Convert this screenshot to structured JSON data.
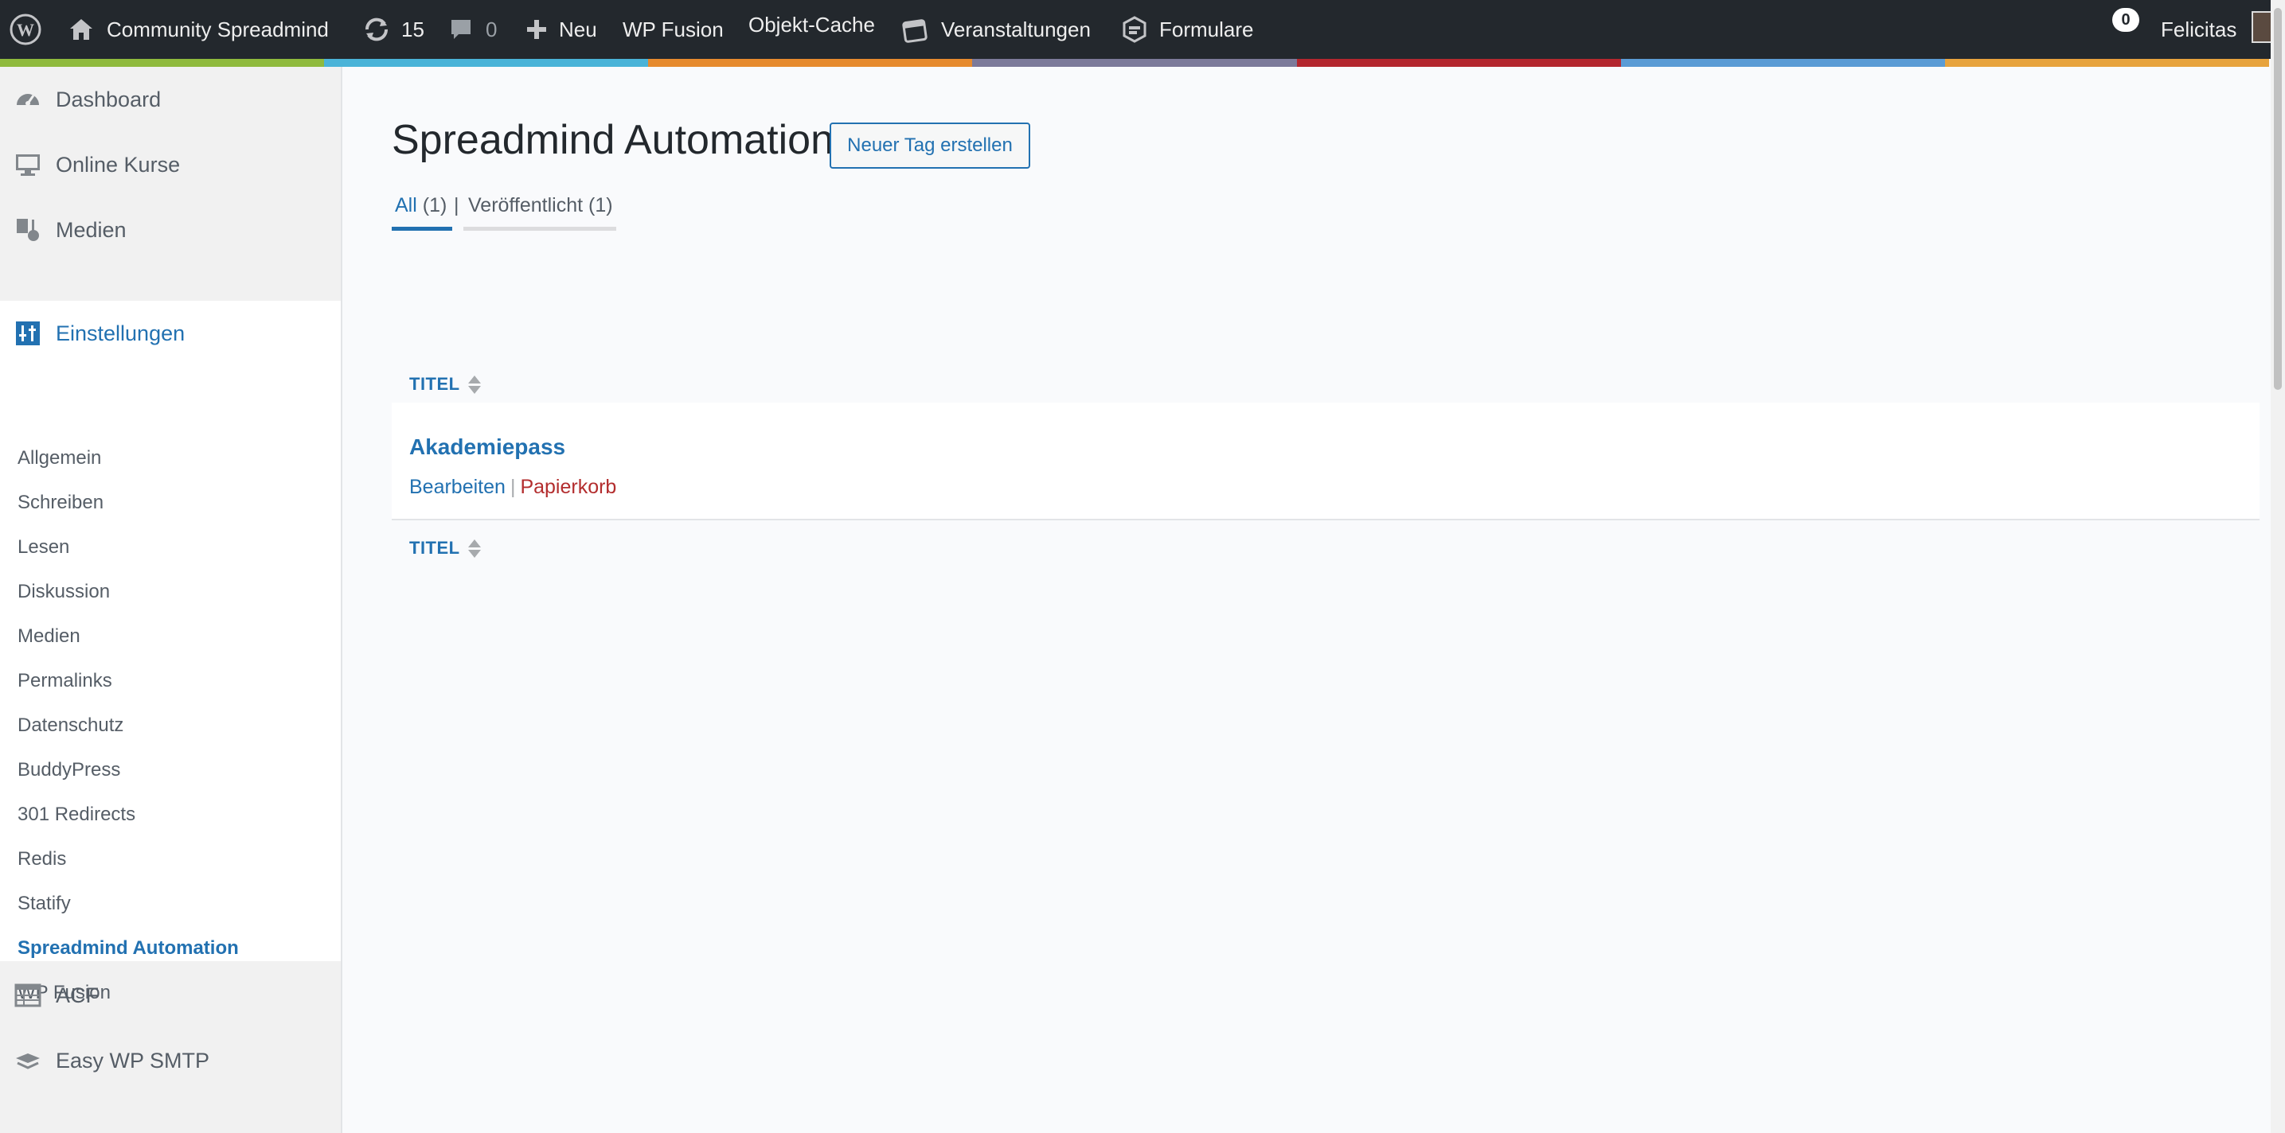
{
  "adminbar": {
    "site_name": "Community Spreadmind",
    "updates_count": "15",
    "comments_count": "0",
    "new_label": "Neu",
    "wp_fusion_label": "WP Fusion",
    "object_cache_label": "Objekt-Cache",
    "events_label": "Veranstaltungen",
    "forms_label": "Formulare",
    "notifications_count": "0",
    "user_name": "Felicitas",
    "colorbar": [
      "#8fba3d",
      "#4ab3d8",
      "#e68a2e",
      "#7c7a9a",
      "#b3262e",
      "#5a9bd5",
      "#e7a33d"
    ]
  },
  "sidebar": {
    "items_top": [
      {
        "label": "Dashboard",
        "icon": "dashboard-icon"
      },
      {
        "label": "Online Kurse",
        "icon": "monitor-icon"
      },
      {
        "label": "Medien",
        "icon": "media-icon"
      }
    ],
    "settings": {
      "label": "Einstellungen",
      "icon": "settings-icon",
      "submenu": [
        "Allgemein",
        "Schreiben",
        "Lesen",
        "Diskussion",
        "Medien",
        "Permalinks",
        "Datenschutz",
        "BuddyPress",
        "301 Redirects",
        "Redis",
        "Statify",
        "Spreadmind Automation",
        "WP Fusion"
      ],
      "current": "Spreadmind Automation"
    },
    "items_bottom": [
      {
        "label": "ACF",
        "icon": "table-icon"
      },
      {
        "label": "Easy WP SMTP",
        "icon": "mail-icon"
      }
    ]
  },
  "main": {
    "title": "Spreadmind Automation",
    "new_button": "Neuer Tag erstellen",
    "filters": {
      "all_label": "All",
      "all_count": "(1)",
      "separator": "|",
      "published_label": "Veröffentlicht (1)"
    },
    "column_header": "TITEL",
    "rows": [
      {
        "title": "Akademiepass",
        "edit": "Bearbeiten",
        "separator": "|",
        "trash": "Papierkorb"
      }
    ]
  },
  "colors": {
    "accent": "#2271b1",
    "danger": "#b32d2e",
    "adminbar_bg": "#23282d"
  }
}
